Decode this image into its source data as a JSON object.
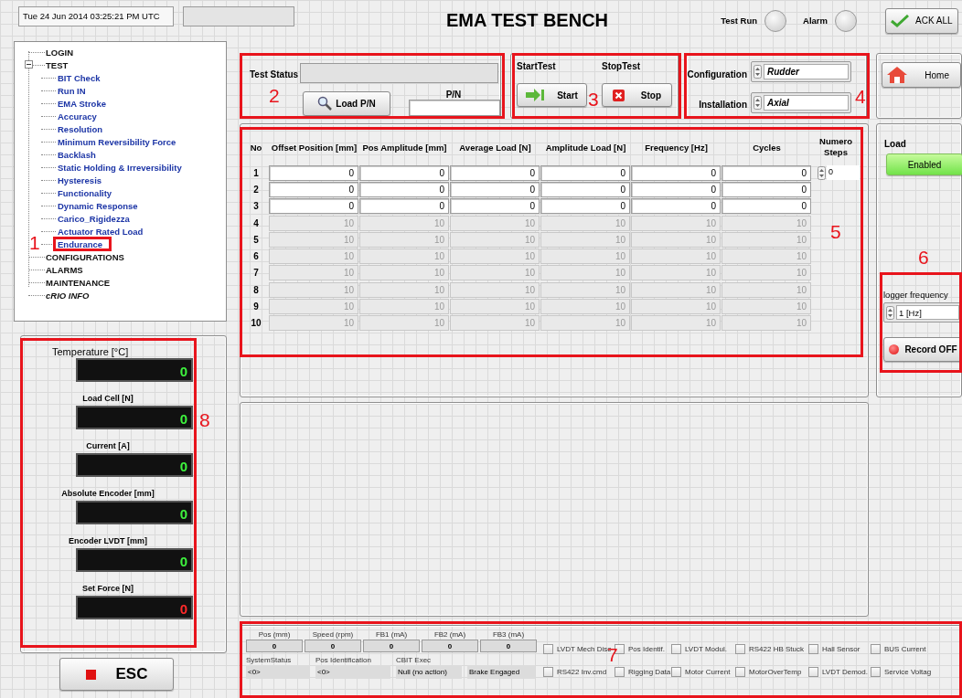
{
  "header": {
    "datetime": "Tue 24 Jun 2014 03:25:21 PM UTC",
    "title": "EMA TEST BENCH",
    "indicators": [
      {
        "label": "Test Run",
        "on": false
      },
      {
        "label": "Alarm",
        "on": false
      }
    ],
    "ack_button": "ACK ALL"
  },
  "nav_tree": [
    {
      "label": "LOGIN",
      "kind": "section"
    },
    {
      "label": "TEST",
      "kind": "section",
      "expanded": true,
      "children": [
        {
          "label": "BIT Check",
          "kind": "test"
        },
        {
          "label": "Run IN",
          "kind": "test"
        },
        {
          "label": "EMA Stroke",
          "kind": "test"
        },
        {
          "label": "Accuracy",
          "kind": "test"
        },
        {
          "label": "Resolution",
          "kind": "test"
        },
        {
          "label": "Minimum Reversibility Force",
          "kind": "test"
        },
        {
          "label": "Backlash",
          "kind": "test"
        },
        {
          "label": "Static Holding & Irreversibility",
          "kind": "test"
        },
        {
          "label": "Hysteresis",
          "kind": "test"
        },
        {
          "label": "Functionality",
          "kind": "test"
        },
        {
          "label": "Dynamic Response",
          "kind": "test"
        },
        {
          "label": "Carico_Rigidezza",
          "kind": "test"
        },
        {
          "label": "Actuator Rated Load",
          "kind": "test"
        },
        {
          "label": "Endurance",
          "kind": "test"
        }
      ]
    },
    {
      "label": "CONFIGURATIONS",
      "kind": "section"
    },
    {
      "label": "ALARMS",
      "kind": "section"
    },
    {
      "label": "MAINTENANCE",
      "kind": "section"
    },
    {
      "label": "cRIO INFO",
      "kind": "info"
    }
  ],
  "gauges": [
    {
      "label": "Temperature [°C]",
      "value": "0",
      "alarm": false
    },
    {
      "label": "Load Cell [N]",
      "value": "0",
      "alarm": false
    },
    {
      "label": "Current  [A]",
      "value": "0",
      "alarm": false
    },
    {
      "label": "Absolute Encoder  [mm]",
      "value": "0",
      "alarm": false
    },
    {
      "label": "Encoder LVDT [mm]",
      "value": "0",
      "alarm": false
    },
    {
      "label": "Set Force [N]",
      "value": "0",
      "alarm": true
    }
  ],
  "esc_button": "ESC",
  "test_status": {
    "label": "Test Status",
    "load_button": "Load P/N",
    "pn_label": "P/N"
  },
  "test_control": {
    "start_label": "StartTest",
    "start_button": "Start",
    "stop_label": "StopTest",
    "stop_button": "Stop"
  },
  "setup": [
    {
      "label": "Configuration",
      "value": "Rudder"
    },
    {
      "label": "Installation",
      "value": "Axial"
    }
  ],
  "home_button": "Home",
  "steps_table": {
    "columns": [
      "No",
      "Offset Position [mm]",
      "Pos Amplitude [mm]",
      "Average Load [N]",
      "Amplitude Load [N]",
      "Frequency [Hz]",
      "Cycles"
    ],
    "rows": [
      {
        "no": "1",
        "disabled": false,
        "values": [
          "0",
          "0",
          "0",
          "0",
          "0",
          "0"
        ]
      },
      {
        "no": "2",
        "disabled": false,
        "values": [
          "0",
          "0",
          "0",
          "0",
          "0",
          "0"
        ]
      },
      {
        "no": "3",
        "disabled": false,
        "values": [
          "0",
          "0",
          "0",
          "0",
          "0",
          "0"
        ]
      },
      {
        "no": "4",
        "disabled": true,
        "values": [
          "10",
          "10",
          "10",
          "10",
          "10",
          "10"
        ]
      },
      {
        "no": "5",
        "disabled": true,
        "values": [
          "10",
          "10",
          "10",
          "10",
          "10",
          "10"
        ]
      },
      {
        "no": "6",
        "disabled": true,
        "values": [
          "10",
          "10",
          "10",
          "10",
          "10",
          "10"
        ]
      },
      {
        "no": "7",
        "disabled": true,
        "values": [
          "10",
          "10",
          "10",
          "10",
          "10",
          "10"
        ]
      },
      {
        "no": "8",
        "disabled": true,
        "values": [
          "10",
          "10",
          "10",
          "10",
          "10",
          "10"
        ]
      },
      {
        "no": "9",
        "disabled": true,
        "values": [
          "10",
          "10",
          "10",
          "10",
          "10",
          "10"
        ]
      },
      {
        "no": "10",
        "disabled": true,
        "values": [
          "10",
          "10",
          "10",
          "10",
          "10",
          "10"
        ]
      }
    ],
    "steps": {
      "label": "Numero Steps",
      "value": "0"
    }
  },
  "load": {
    "label": "Load",
    "button": "Enabled",
    "on": true
  },
  "logger": {
    "label": "logger frequency",
    "value": "1 [Hz]",
    "record_button": "Record OFF",
    "recording": false
  },
  "status_strip": {
    "readouts": [
      {
        "label": "Pos (mm)",
        "value": "0"
      },
      {
        "label": "Speed (rpm)",
        "value": "0"
      },
      {
        "label": "FB1 (mA)",
        "value": "0"
      },
      {
        "label": "FB2 (mA)",
        "value": "0"
      },
      {
        "label": "FB3 (mA)",
        "value": "0"
      }
    ],
    "fields": [
      {
        "label": "SystemStatus",
        "value": "<0>"
      },
      {
        "label": "Pos Identification",
        "value": "<0>"
      },
      {
        "label": "CBIT Exec",
        "value": "Null (no action)"
      },
      {
        "value": "Brake Engaged"
      }
    ],
    "flags": [
      {
        "label": "LVDT Mech Disc",
        "checked": false
      },
      {
        "label": "RS422 Inv.cmd",
        "checked": false
      },
      {
        "label": "Pos Identif.",
        "checked": false
      },
      {
        "label": "Rigging Data",
        "checked": false
      },
      {
        "label": "LVDT Modul.",
        "checked": false
      },
      {
        "label": "Motor Current",
        "checked": false
      },
      {
        "label": "RS422 HB Stuck",
        "checked": false
      },
      {
        "label": "MotorOverTemp",
        "checked": false
      },
      {
        "label": "Hall Sensor",
        "checked": false
      },
      {
        "label": "LVDT Demod.",
        "checked": false
      },
      {
        "label": "BUS Current",
        "checked": false
      },
      {
        "label": "Service Voltag",
        "checked": false
      }
    ]
  },
  "annotations": [
    {
      "number": "1"
    },
    {
      "number": "2"
    },
    {
      "number": "3"
    },
    {
      "number": "4"
    },
    {
      "number": "5"
    },
    {
      "number": "6"
    },
    {
      "number": "7"
    },
    {
      "number": "8"
    }
  ]
}
